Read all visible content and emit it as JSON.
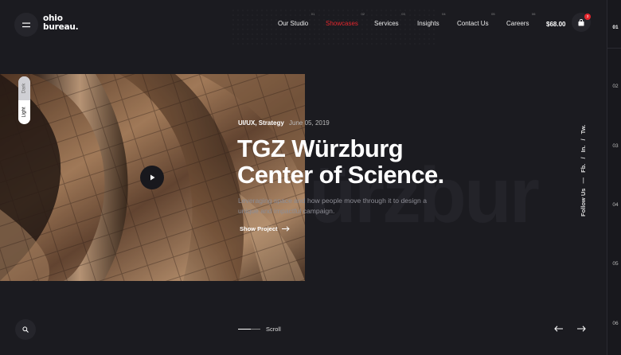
{
  "brand": {
    "line1": "ohio",
    "line2": "bureau."
  },
  "nav": [
    {
      "num": "01",
      "label": "Our Studio",
      "active": false
    },
    {
      "num": "02",
      "label": "Showcases",
      "active": true
    },
    {
      "num": "03",
      "label": "Services",
      "active": false
    },
    {
      "num": "04",
      "label": "Insights",
      "active": false
    },
    {
      "num": "05",
      "label": "Contact Us",
      "active": false
    },
    {
      "num": "06",
      "label": "Careers",
      "active": false
    }
  ],
  "cart": {
    "price": "$68.00",
    "count": "3"
  },
  "slides": [
    "01",
    "02",
    "03",
    "04",
    "05",
    "06"
  ],
  "theme": {
    "dark": "Dark",
    "light": "Light"
  },
  "hero": {
    "category": "UI/UX, Strategy",
    "date": "June 05, 2019",
    "title_line1": "TGZ Würzburg",
    "title_line2": "Center of Science.",
    "description": "Leveraging space and how people move through it to design a unique and impactful campaign.",
    "link": "Show Project",
    "ghost": "ürzbur"
  },
  "follow": {
    "label": "Follow Us",
    "dash": "—",
    "links": [
      "Fb.",
      "In.",
      "Tw."
    ],
    "sep": "/"
  },
  "footer": {
    "scroll": "Scroll"
  },
  "colors": {
    "accent": "#e3262d",
    "background": "#1b1b20"
  },
  "icons": [
    "menu-icon",
    "cart-icon",
    "play-icon",
    "arrow-right-icon",
    "search-icon",
    "arrow-left-icon"
  ]
}
